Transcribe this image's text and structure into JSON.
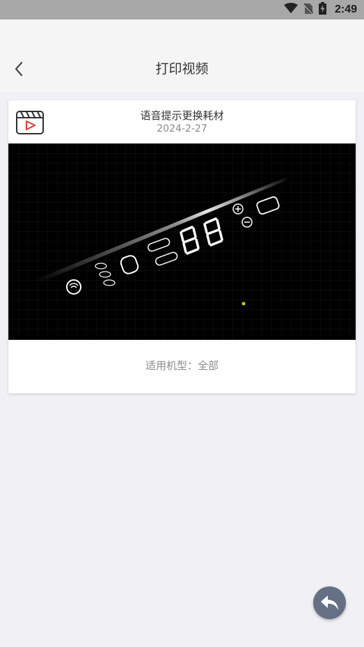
{
  "status_bar": {
    "time": "2:49",
    "icons": [
      "wifi-icon",
      "no-sim-icon",
      "battery-charging-icon"
    ]
  },
  "app_bar": {
    "title": "打印视频",
    "back_icon": "chevron-left-icon"
  },
  "video_card": {
    "title": "语音提示更换耗材",
    "date": "2024-2-27",
    "thumbnail_icon": "video-clapper-icon",
    "model_label": "适用机型：全部"
  },
  "fab": {
    "icon": "reply-arrow-icon",
    "color": "#667085"
  },
  "colors": {
    "status_bar": "#a8a8a8",
    "background": "#f0f0f5",
    "video_icon_accent": "#e53935"
  }
}
